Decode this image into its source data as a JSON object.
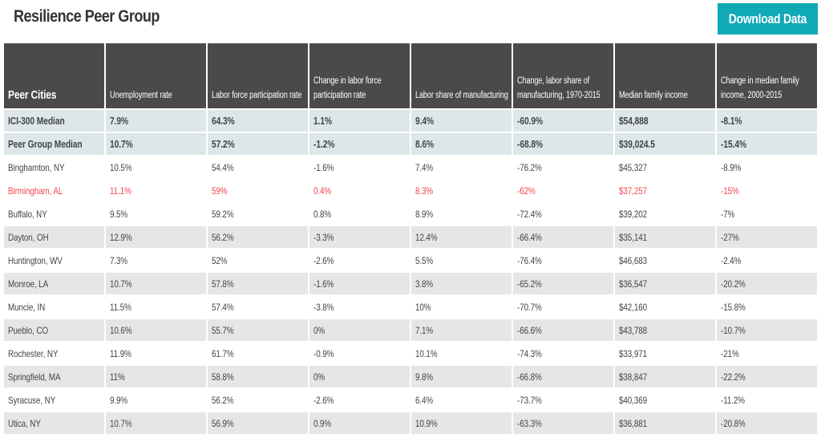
{
  "page": {
    "title": "Resilience Peer Group",
    "download_button": "Download Data"
  },
  "table": {
    "headers": [
      "Peer Cities",
      "Unemployment rate",
      "Labor force participation rate",
      "Change in labor force participation rate",
      "Labor share of manufacturing",
      "Change, labor share of manufacturing, 1970-2015",
      "Median family income",
      "Change in median family income, 2000-2015"
    ],
    "highlight_color": "#f2454d",
    "accent_color": "#10a9b6",
    "rows": [
      {
        "type": "median",
        "cells": [
          "ICI-300 Median",
          "7.9%",
          "64.3%",
          "1.1%",
          "9.4%",
          "-60.9%",
          "$54,888",
          "-8.1%"
        ]
      },
      {
        "type": "median",
        "cells": [
          "Peer Group Median",
          "10.7%",
          "57.2%",
          "-1.2%",
          "8.6%",
          "-68.8%",
          "$39,024.5",
          "-15.4%"
        ]
      },
      {
        "type": "plain",
        "cells": [
          "Binghamton, NY",
          "10.5%",
          "54.4%",
          "-1.6%",
          "7.4%",
          "-76.2%",
          "$45,327",
          "-8.9%"
        ]
      },
      {
        "type": "highlight",
        "cells": [
          "Birmingham, AL",
          "11.1%",
          "59%",
          "0.4%",
          "8.3%",
          "-62%",
          "$37,257",
          "-15%"
        ]
      },
      {
        "type": "plain",
        "cells": [
          "Buffalo, NY",
          "9.5%",
          "59.2%",
          "0.8%",
          "8.9%",
          "-72.4%",
          "$39,202",
          "-7%"
        ]
      },
      {
        "type": "alt",
        "cells": [
          "Dayton, OH",
          "12.9%",
          "56.2%",
          "-3.3%",
          "12.4%",
          "-66.4%",
          "$35,141",
          "-27%"
        ]
      },
      {
        "type": "plain",
        "cells": [
          "Huntington, WV",
          "7.3%",
          "52%",
          "-2.6%",
          "5.5%",
          "-76.4%",
          "$46,683",
          "-2.4%"
        ]
      },
      {
        "type": "alt",
        "cells": [
          "Monroe, LA",
          "10.7%",
          "57.8%",
          "-1.6%",
          "3.8%",
          "-65.2%",
          "$36,547",
          "-20.2%"
        ]
      },
      {
        "type": "plain",
        "cells": [
          "Muncie, IN",
          "11.5%",
          "57.4%",
          "-3.8%",
          "10%",
          "-70.7%",
          "$42,160",
          "-15.8%"
        ]
      },
      {
        "type": "alt",
        "cells": [
          "Pueblo, CO",
          "10.6%",
          "55.7%",
          "0%",
          "7.1%",
          "-66.6%",
          "$43,788",
          "-10.7%"
        ]
      },
      {
        "type": "plain",
        "cells": [
          "Rochester, NY",
          "11.9%",
          "61.7%",
          "-0.9%",
          "10.1%",
          "-74.3%",
          "$33,971",
          "-21%"
        ]
      },
      {
        "type": "alt",
        "cells": [
          "Springfield, MA",
          "11%",
          "58.8%",
          "0%",
          "9.8%",
          "-66.8%",
          "$38,847",
          "-22.2%"
        ]
      },
      {
        "type": "plain",
        "cells": [
          "Syracuse, NY",
          "9.9%",
          "56.2%",
          "-2.6%",
          "6.4%",
          "-73.7%",
          "$40,369",
          "-11.2%"
        ]
      },
      {
        "type": "alt",
        "cells": [
          "Utica, NY",
          "10.7%",
          "56.9%",
          "0.9%",
          "10.9%",
          "-63.3%",
          "$36,881",
          "-20.8%"
        ]
      }
    ]
  }
}
